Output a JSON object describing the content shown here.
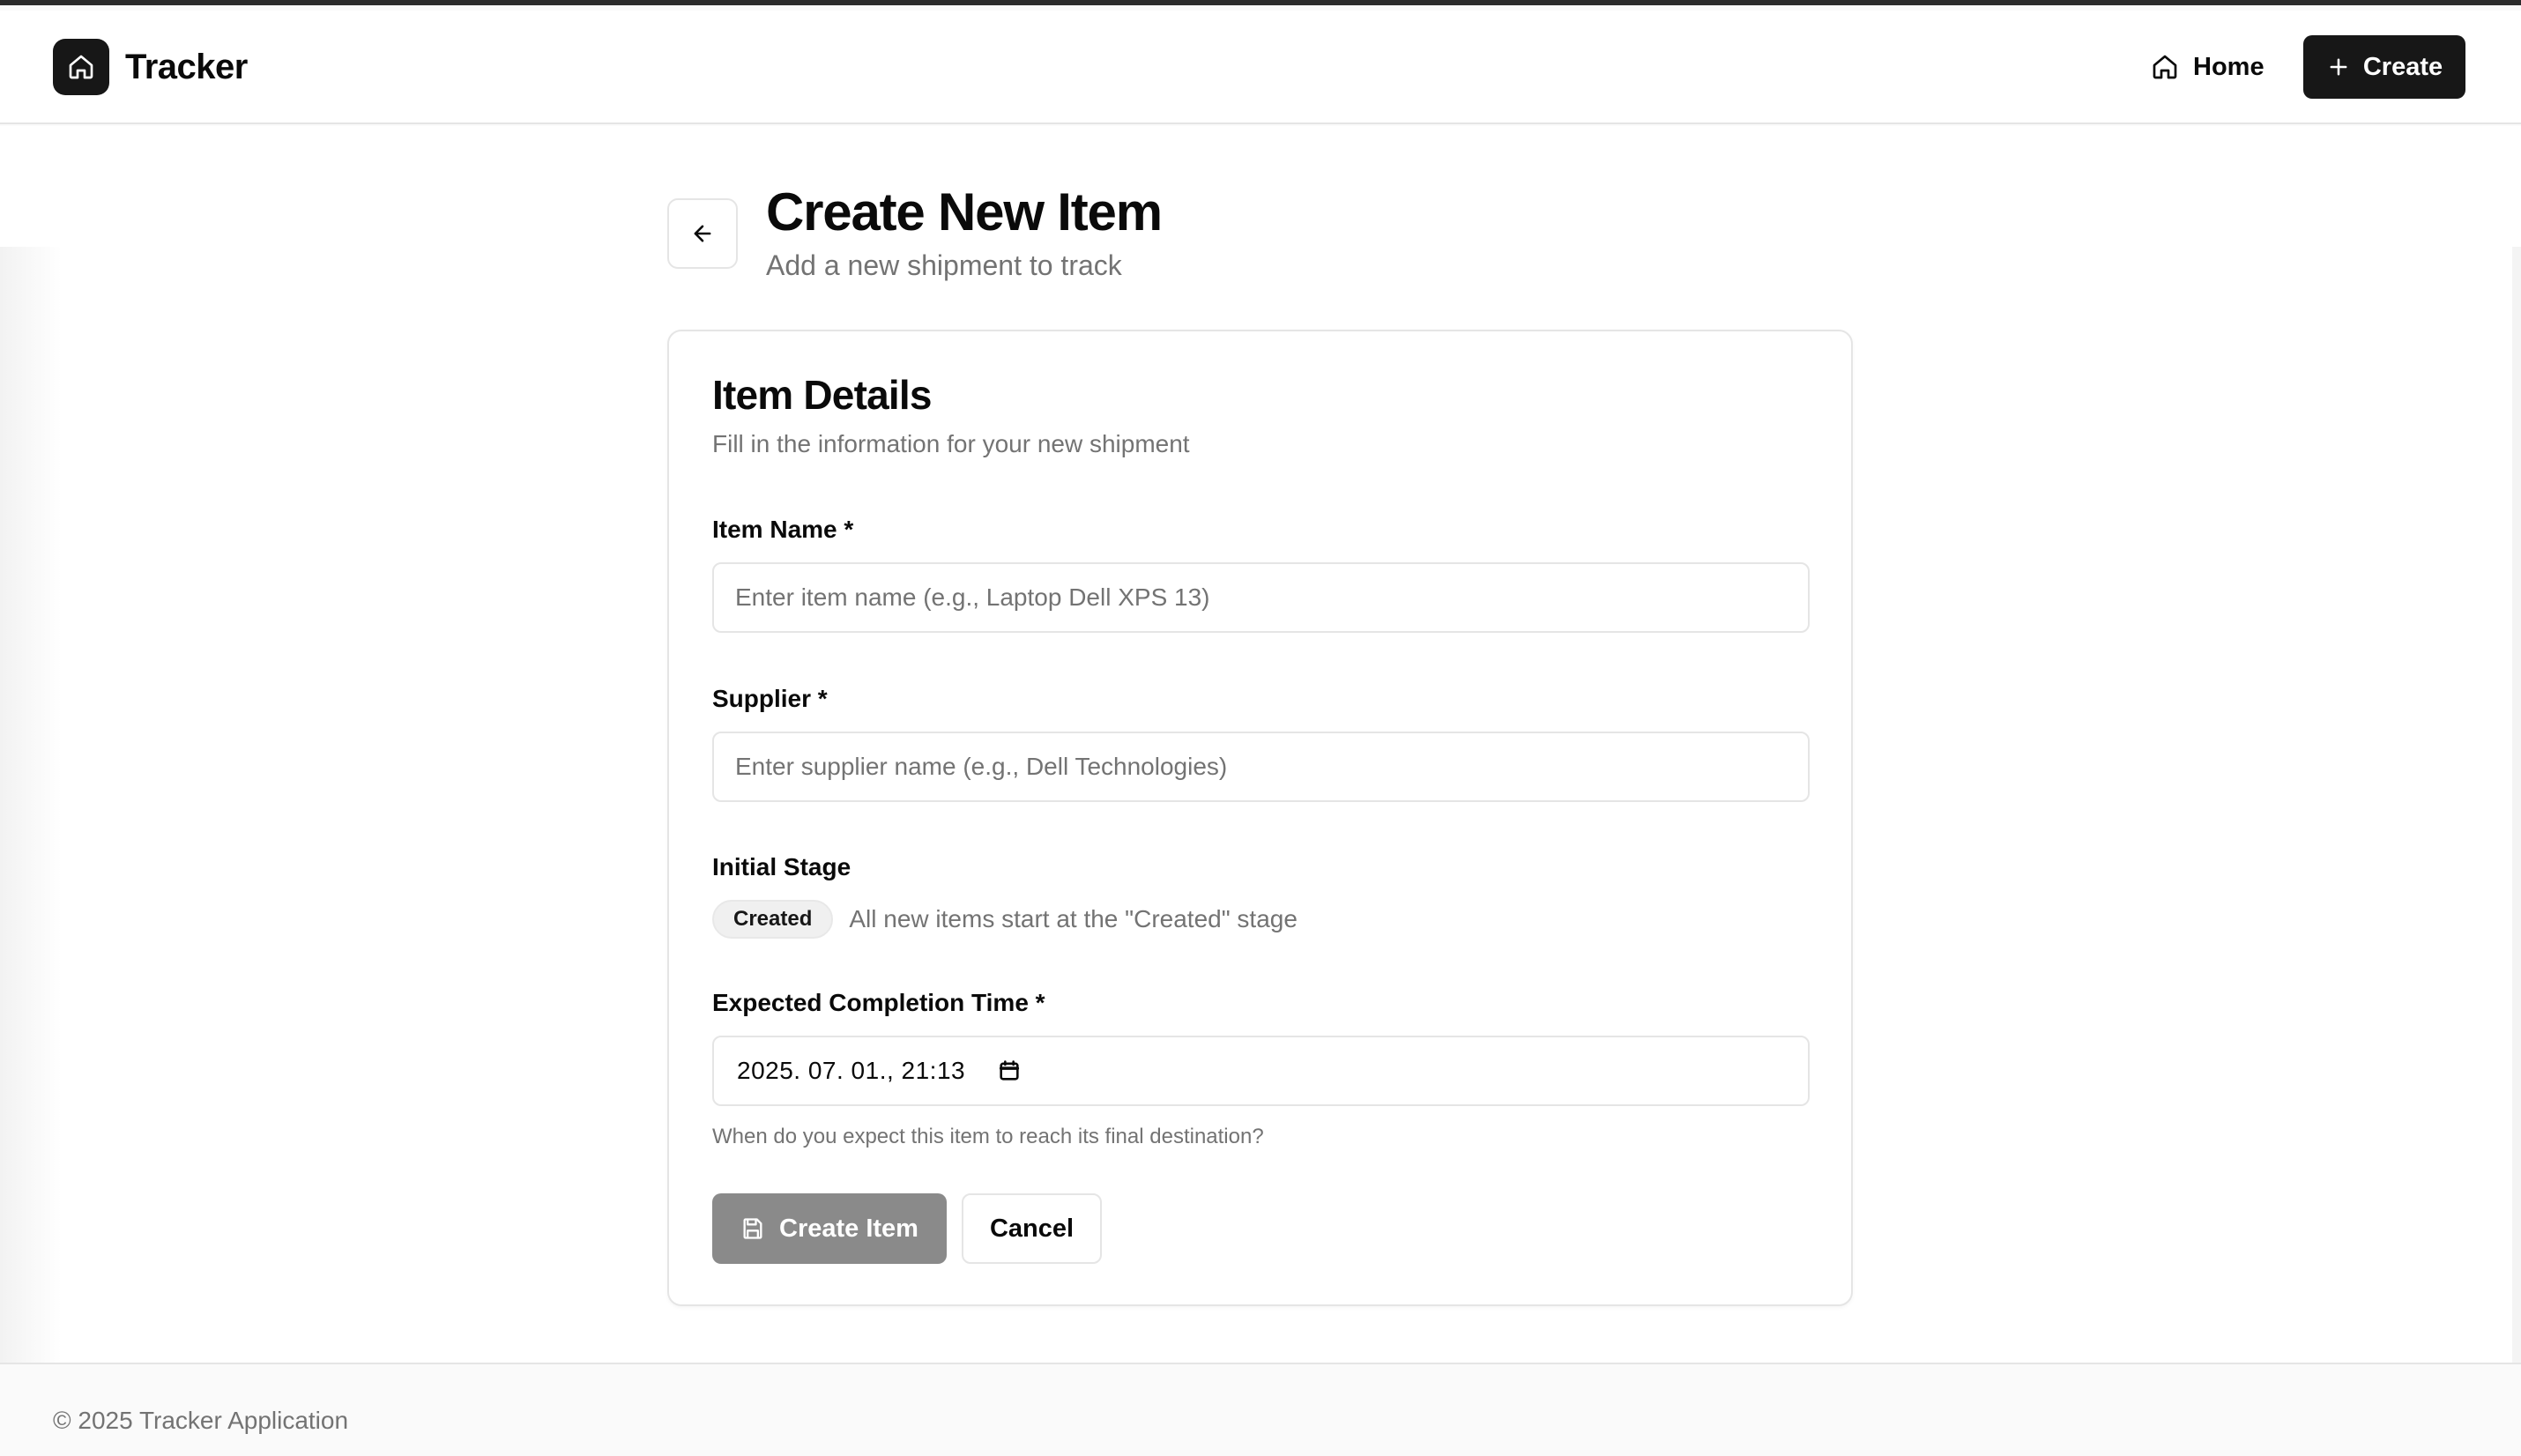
{
  "app": {
    "brand": "Tracker",
    "brand_icon": "home-icon"
  },
  "nav": {
    "home_label": "Home",
    "home_icon": "home-icon",
    "create_label": "Create",
    "create_icon": "plus-icon"
  },
  "page": {
    "title": "Create New Item",
    "subtitle": "Add a new shipment to track",
    "back_icon": "arrow-left-icon"
  },
  "form": {
    "card_title": "Item Details",
    "card_description": "Fill in the information for your new shipment",
    "item_name": {
      "label": "Item Name *",
      "placeholder": "Enter item name (e.g., Laptop Dell XPS 13)",
      "value": ""
    },
    "supplier": {
      "label": "Supplier *",
      "placeholder": "Enter supplier name (e.g., Dell Technologies)",
      "value": ""
    },
    "initial_stage": {
      "label": "Initial Stage",
      "badge": "Created",
      "note": "All new items start at the \"Created\" stage"
    },
    "expected_completion": {
      "label": "Expected Completion Time *",
      "value": "2025. 07. 01., 21:13",
      "hint": "When do you expect this item to reach its final destination?",
      "icon": "calendar-icon"
    },
    "submit_label": "Create Item",
    "submit_icon": "save-icon",
    "cancel_label": "Cancel"
  },
  "footer": {
    "text": "© 2025 Tracker Application"
  },
  "colors": {
    "primary": "#171717",
    "primary_disabled": "#8a8a8a",
    "muted_text": "#737373",
    "border": "#e5e5e5",
    "background": "#fafafa"
  }
}
